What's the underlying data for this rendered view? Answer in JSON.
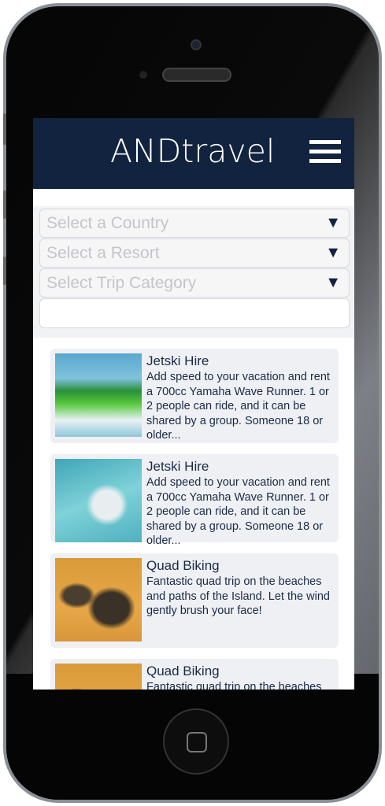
{
  "app": {
    "title": "ANDtravel"
  },
  "header": {
    "menu_icon": "hamburger-icon"
  },
  "filters": {
    "country_placeholder": "Select a Country",
    "resort_placeholder": "Select a Resort",
    "category_placeholder": "Select Trip Category",
    "arrow": "▼",
    "search_value": ""
  },
  "trips": [
    {
      "title": "Jetski Hire",
      "description": "Add speed to your vacation and rent a 700cc Yamaha Wave Runner. 1 or 2 people can ride, and it can be shared by a group. Someone 18 or older..."
    },
    {
      "title": "Jetski Hire",
      "description": "Add speed to your vacation and rent a 700cc Yamaha Wave Runner. 1 or 2 people can ride, and it can be shared by a group. Someone 18 or older..."
    },
    {
      "title": "Quad Biking",
      "description": "Fantastic quad trip on the beaches and paths of the Island. Let the wind gently brush your face!"
    },
    {
      "title": "Quad Biking",
      "description": "Fantastic quad trip on the beaches and paths of the Island. Let the wind gently brush your face!"
    }
  ],
  "colors": {
    "header": "#12233f",
    "card": "#eef0f4",
    "text": "#1b2a44"
  }
}
